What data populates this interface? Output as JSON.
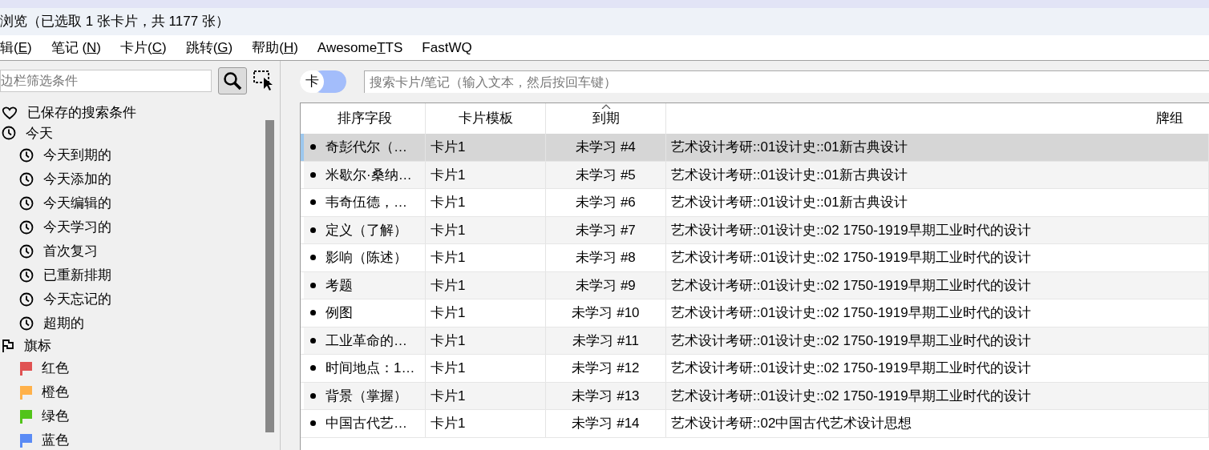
{
  "window": {
    "title": "浏览（已选取 1 张卡片，共 1177 张）"
  },
  "menu": [
    {
      "before": "辑(",
      "key": "E",
      "after": ")"
    },
    {
      "before": "笔记 (",
      "key": "N",
      "after": ")"
    },
    {
      "before": "卡片(",
      "key": "C",
      "after": ")"
    },
    {
      "before": "跳转(",
      "key": "G",
      "after": ")"
    },
    {
      "before": "帮助(",
      "key": "H",
      "after": ")"
    },
    {
      "before": "Awesome",
      "key": "T",
      "after": "TS"
    },
    {
      "before": "FastWQ"
    }
  ],
  "sidebar": {
    "filter": {
      "placeholder": "边栏筛选条件"
    },
    "items": [
      {
        "label": "已保存的搜索条件"
      },
      {
        "label": "今天",
        "children": [
          {
            "label": "今天到期的"
          },
          {
            "label": "今天添加的"
          },
          {
            "label": "今天编辑的"
          },
          {
            "label": "今天学习的"
          },
          {
            "label": "首次复习"
          },
          {
            "label": "已重新排期"
          },
          {
            "label": "今天忘记的"
          },
          {
            "label": "超期的"
          }
        ]
      },
      {
        "label": "旗标",
        "children": [
          {
            "label": "红色",
            "color": "#e05252"
          },
          {
            "label": "橙色",
            "color": "#ffb14a"
          },
          {
            "label": "绿色",
            "color": "#52c41a"
          },
          {
            "label": "蓝色",
            "color": "#5a8bf5"
          }
        ]
      }
    ]
  },
  "toggle": {
    "label": "卡",
    "on": true
  },
  "search": {
    "placeholder": "搜索卡片/笔记（输入文本，然后按回车键）"
  },
  "table": {
    "columns": [
      {
        "label": "排序字段",
        "sorted": false
      },
      {
        "label": "卡片模板",
        "sorted": false
      },
      {
        "label": "到期",
        "sorted": true
      },
      {
        "label": "牌组",
        "sorted": false
      }
    ],
    "rows": [
      {
        "selected": true,
        "cells": [
          "奇彭代尔（…",
          "卡片1",
          "未学习 #4",
          "艺术设计考研::01设计史::01新古典设计"
        ]
      },
      {
        "selected": false,
        "cells": [
          "米歇尔·桑纳…",
          "卡片1",
          "未学习 #5",
          "艺术设计考研::01设计史::01新古典设计"
        ]
      },
      {
        "selected": false,
        "cells": [
          "韦奇伍德，…",
          "卡片1",
          "未学习 #6",
          "艺术设计考研::01设计史::01新古典设计"
        ]
      },
      {
        "selected": false,
        "cells": [
          "定义（了解）",
          "卡片1",
          "未学习 #7",
          "艺术设计考研::01设计史::02 1750-1919早期工业时代的设计"
        ]
      },
      {
        "selected": false,
        "cells": [
          "影响（陈述）",
          "卡片1",
          "未学习 #8",
          "艺术设计考研::01设计史::02 1750-1919早期工业时代的设计"
        ]
      },
      {
        "selected": false,
        "cells": [
          "考题",
          "卡片1",
          "未学习 #9",
          "艺术设计考研::01设计史::02 1750-1919早期工业时代的设计"
        ]
      },
      {
        "selected": false,
        "cells": [
          "例图",
          "卡片1",
          "未学习 #10",
          "艺术设计考研::01设计史::02 1750-1919早期工业时代的设计"
        ]
      },
      {
        "selected": false,
        "cells": [
          "工业革命的…",
          "卡片1",
          "未学习 #11",
          "艺术设计考研::01设计史::02 1750-1919早期工业时代的设计"
        ]
      },
      {
        "selected": false,
        "cells": [
          "时间地点：1…",
          "卡片1",
          "未学习 #12",
          "艺术设计考研::01设计史::02 1750-1919早期工业时代的设计"
        ]
      },
      {
        "selected": false,
        "cells": [
          "背景（掌握）",
          "卡片1",
          "未学习 #13",
          "艺术设计考研::01设计史::02 1750-1919早期工业时代的设计"
        ]
      },
      {
        "selected": false,
        "cells": [
          "中国古代艺…",
          "卡片1",
          "未学习 #14",
          "艺术设计考研::02中国古代艺术设计思想"
        ]
      }
    ]
  }
}
